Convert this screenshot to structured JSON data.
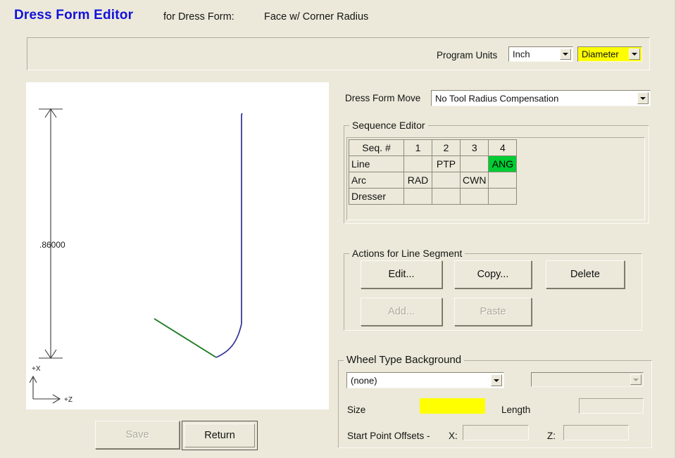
{
  "header": {
    "app_title": "Dress Form Editor",
    "subtitle_label": "for Dress Form:",
    "subtitle_value": "Face w/ Corner Radius"
  },
  "units_panel": {
    "program_units_label": "Program Units",
    "units_value": "Inch",
    "mode_value": "Diameter",
    "mode_highlight_color": "#FFFF00"
  },
  "dress_form_move": {
    "label": "Dress Form Move",
    "value": "No Tool Radius Compensation"
  },
  "sequence_editor": {
    "title": "Sequence Editor",
    "corner_header": "Seq. #",
    "columns": [
      "1",
      "2",
      "3",
      "4"
    ],
    "rows": [
      {
        "label": "Line",
        "cells": [
          "",
          "PTP",
          "",
          "ANG"
        ],
        "selected_index": 3
      },
      {
        "label": "Arc",
        "cells": [
          "RAD",
          "",
          "CWN",
          ""
        ],
        "selected_index": -1
      },
      {
        "label": "Dresser",
        "cells": [
          "",
          "",
          "",
          ""
        ],
        "selected_index": -1
      }
    ],
    "selection_color": "#00CC33"
  },
  "actions": {
    "title": "Actions for Line Segment",
    "edit_label": "Edit...",
    "copy_label": "Copy...",
    "delete_label": "Delete",
    "add_label": "Add...",
    "paste_label": "Paste"
  },
  "wheel_background": {
    "title": "Wheel Type Background",
    "type_value": "(none)",
    "extra_value": "",
    "size_label": "Size",
    "size_value": "",
    "size_highlight_color": "#FFFF00",
    "length_label": "Length",
    "length_value": "",
    "offsets_label": "Start Point Offsets -",
    "x_label": "X:",
    "x_value": "",
    "z_label": "Z:",
    "z_value": ""
  },
  "canvas": {
    "dimension_label": ".86000",
    "axis_x_label": "+X",
    "axis_z_label": "+Z",
    "line_color": "#2E2E96",
    "segment_color": "#1E7B23"
  },
  "footer": {
    "save_label": "Save",
    "return_label": "Return"
  }
}
